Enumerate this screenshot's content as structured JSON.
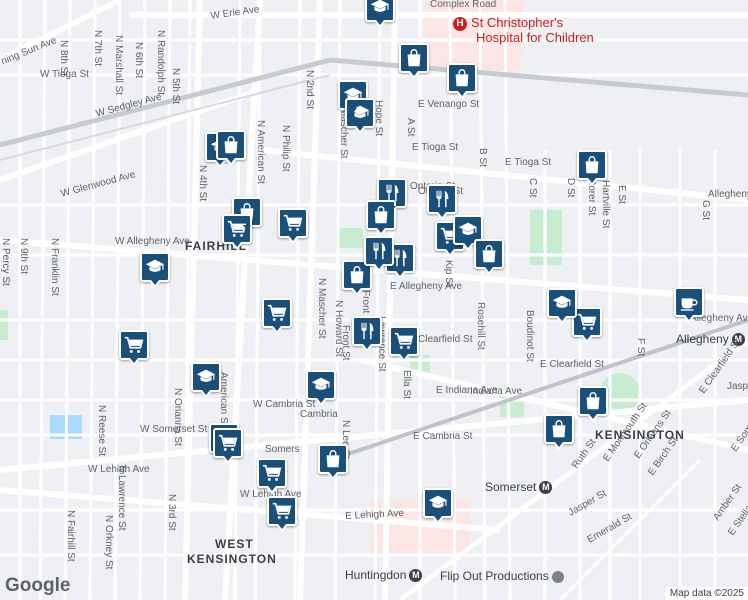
{
  "districts": [
    "FAIRHILL",
    "KENSINGTON",
    "WEST",
    "KENSINGTON"
  ],
  "hospital": {
    "name": "St Christopher's",
    "name2": "Hospital for Children",
    "complex": "Complex Road"
  },
  "stations": {
    "allegheny": "Allegheny",
    "somerset": "Somerset",
    "huntingdon": "Huntingdon",
    "metro_symbol": "M"
  },
  "poi": {
    "flipout": "Flip Out Productions"
  },
  "streets": [
    "W Erie Ave",
    "ning Sun Ave",
    "N 8th St",
    "N 7th St",
    "N Marshall St",
    "N 6th St",
    "N Randolph St",
    "N 5th St",
    "W Tioga St",
    "W Sedgley Ave",
    "N 2nd St",
    "E Venango St",
    "N American St",
    "N Philip St",
    "E Tioga St",
    "E Tioga St",
    "W Glenwood Ave",
    "N 4th St",
    "W Allegheny Ave",
    "E Allegheny Ave",
    "N Mascher St",
    "N Howard St",
    "N Front St",
    "A St",
    "B St",
    "Kip St",
    "Rosehill St",
    "C St",
    "D St",
    "Rorer St",
    "Hartville St",
    "E St",
    "G St",
    "Boudinot St",
    "F St",
    "E Clearfield St",
    "Ella St",
    "E Indiana Ave",
    "E Cambria St",
    "W Cambria St",
    "W Somerset St",
    "W Lehigh Ave",
    "W Lehigh Ave",
    "E Lehigh Ave",
    "N Lee St",
    "N Reese St",
    "N Orianna St",
    "N 3rd St",
    "N Lawrence St",
    "Ruth St",
    "E Monmouth St",
    "E Orleans St",
    "E Birch St",
    "Jasper St",
    "Emerald St",
    "N Orkney St",
    "N Fairhill St",
    "N Franklin St",
    "N 9th St",
    "N Percy St",
    "Hope St",
    "Allegheny Ave",
    "E Clearfield St",
    "Jasper St",
    "Amber St",
    "E Stella St",
    "E Somerset St",
    "Mascher St",
    "Ontario St",
    "Lawrence St",
    "American St",
    "Somers",
    "Cambria",
    "Front St",
    "Indiana Ave",
    "Clearfield St",
    "Allegheny",
    "Ontario St"
  ],
  "pins": [
    {
      "type": "school"
    },
    {
      "type": "shopping"
    },
    {
      "type": "shopping"
    },
    {
      "type": "school"
    },
    {
      "type": "school"
    },
    {
      "type": "school"
    },
    {
      "type": "shopping"
    },
    {
      "type": "shopping"
    },
    {
      "type": "restaurant"
    },
    {
      "type": "restaurant"
    },
    {
      "type": "grocery"
    },
    {
      "type": "grocery"
    },
    {
      "type": "shopping"
    },
    {
      "type": "grocery"
    },
    {
      "type": "restaurant"
    },
    {
      "type": "restaurant"
    },
    {
      "type": "school"
    },
    {
      "type": "shopping"
    },
    {
      "type": "restaurant"
    },
    {
      "type": "grocery"
    },
    {
      "type": "school"
    },
    {
      "type": "grocery"
    },
    {
      "type": "school"
    },
    {
      "type": "grocery"
    },
    {
      "type": "school"
    },
    {
      "type": "grocery"
    },
    {
      "type": "grocery"
    },
    {
      "type": "shopping"
    },
    {
      "type": "grocery"
    },
    {
      "type": "shopping"
    },
    {
      "type": "grocery"
    },
    {
      "type": "school"
    },
    {
      "type": "cafe"
    },
    {
      "type": "school"
    },
    {
      "type": "shopping"
    },
    {
      "type": "shopping"
    },
    {
      "type": "shopping"
    },
    {
      "type": "grocery"
    }
  ],
  "logo": "Google",
  "attribution": "Map data ©2025"
}
